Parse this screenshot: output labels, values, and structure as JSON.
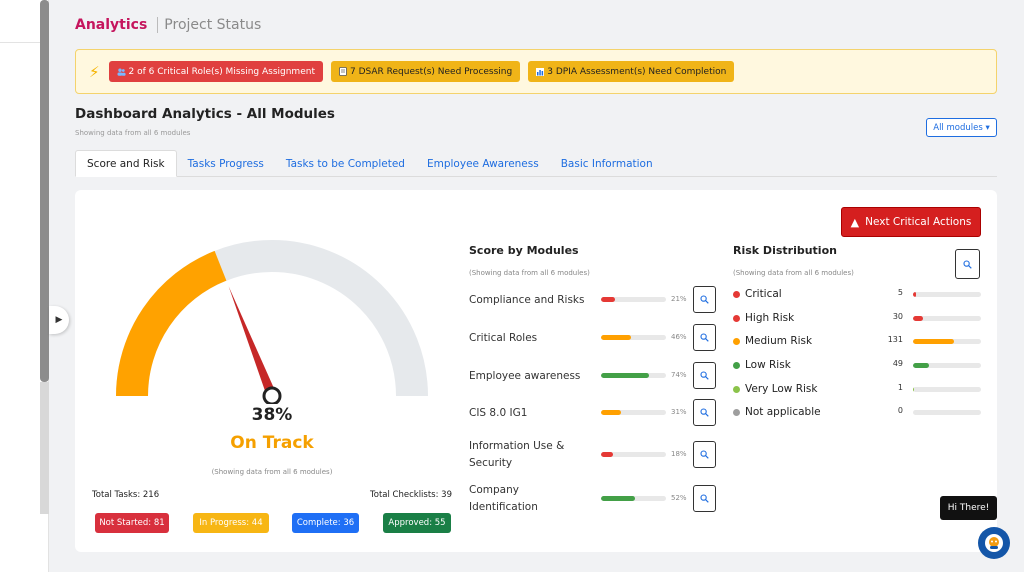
{
  "header": {
    "active_tab": "Analytics",
    "inactive_tab": "Project Status"
  },
  "alerts": [
    {
      "icon": "users-icon",
      "text": "2 of 6 Critical Role(s) Missing Assignment",
      "color": "#e0403f"
    },
    {
      "icon": "document-icon",
      "text": "7 DSAR Request(s) Need Processing",
      "color": "#f0b418"
    },
    {
      "icon": "chart-icon",
      "text": "3 DPIA Assessment(s) Need Completion",
      "color": "#f0b418"
    }
  ],
  "dashboard": {
    "title": "Dashboard Analytics - All Modules",
    "subtitle": "Showing data from all 6 modules",
    "module_filter": "All modules ▾"
  },
  "tabs": [
    "Score and Risk",
    "Tasks Progress",
    "Tasks to be Completed",
    "Employee Awareness",
    "Basic Information"
  ],
  "card": {
    "next_button": "Next Critical Actions",
    "gauge": {
      "percent": 38,
      "percent_label": "38%",
      "status": "On Track",
      "note": "(Showing data from all 6 modules)"
    },
    "total_tasks": "Total Tasks: 216",
    "total_checklists": "Total Checklists: 39",
    "badges": {
      "not_started": "Not Started: 81",
      "in_progress": "In Progress: 44",
      "complete": "Complete: 36",
      "approved": "Approved: 55"
    }
  },
  "score_by_modules": {
    "title": "Score by Modules",
    "subtitle": "(Showing data from all 6 modules)",
    "items": [
      {
        "name": "Compliance and Risks",
        "percent": 21,
        "label": "21%",
        "color": "#e53935"
      },
      {
        "name": "Critical Roles",
        "percent": 46,
        "label": "46%",
        "color": "#ffa000"
      },
      {
        "name": "Employee awareness",
        "percent": 74,
        "label": "74%",
        "color": "#43a047"
      },
      {
        "name": "CIS 8.0 IG1",
        "percent": 31,
        "label": "31%",
        "color": "#ffa000"
      },
      {
        "name": "Information Use & Security",
        "percent": 18,
        "label": "18%",
        "color": "#e53935"
      },
      {
        "name": "Company Identification",
        "percent": 52,
        "label": "52%",
        "color": "#43a047"
      }
    ]
  },
  "risk_distribution": {
    "title": "Risk Distribution",
    "subtitle": "(Showing data from all 6 modules)",
    "items": [
      {
        "name": "Critical",
        "count": "5",
        "fraction": 0.04,
        "color": "#e53935"
      },
      {
        "name": "High Risk",
        "count": "30",
        "fraction": 0.14,
        "color": "#e53935"
      },
      {
        "name": "Medium Risk",
        "count": "131",
        "fraction": 0.6,
        "color": "#ffa000"
      },
      {
        "name": "Low Risk",
        "count": "49",
        "fraction": 0.24,
        "color": "#43a047"
      },
      {
        "name": "Very Low Risk",
        "count": "1",
        "fraction": 0.015,
        "color": "#8bc34a"
      },
      {
        "name": "Not applicable",
        "count": "0",
        "fraction": 0,
        "color": "#9e9e9e"
      }
    ]
  },
  "chat": {
    "greeting": "Hi There!"
  }
}
